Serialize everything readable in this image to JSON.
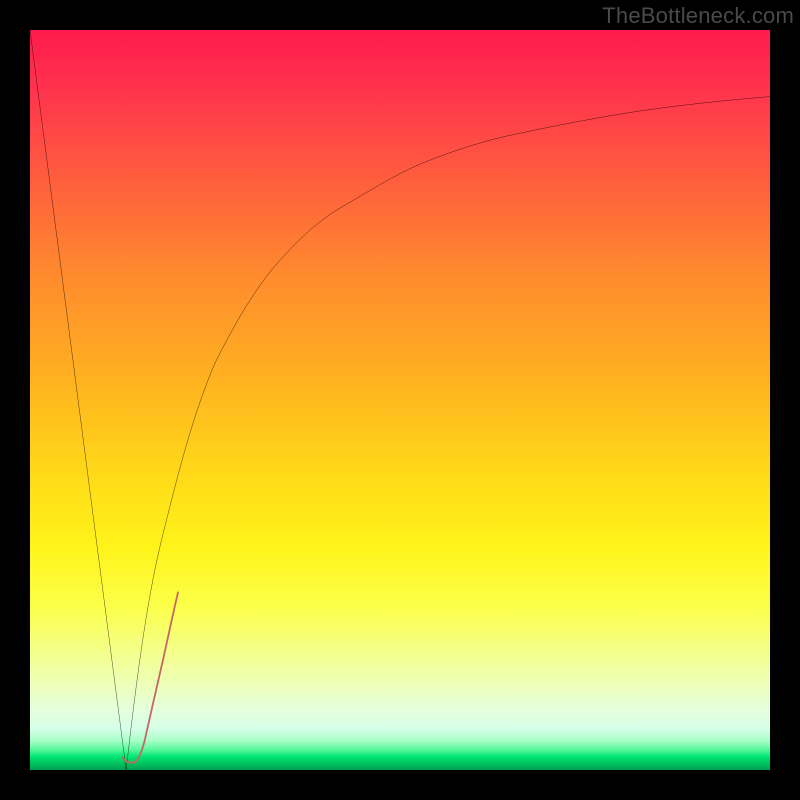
{
  "watermark": "TheBottleneck.com",
  "colors": {
    "frame": "#000000",
    "curve": "#000000",
    "indicator": "#c46767",
    "gradient_top": "#ff1a4d",
    "gradient_mid": "#ffd918",
    "gradient_bottom": "#00c860"
  },
  "chart_data": {
    "type": "line",
    "title": "",
    "xlabel": "",
    "ylabel": "",
    "xlim": [
      0,
      100
    ],
    "ylim": [
      0,
      100
    ],
    "grid": false,
    "legend": false,
    "background": "red-yellow-green vertical gradient",
    "series": [
      {
        "name": "left-descent",
        "x": [
          0,
          13
        ],
        "y": [
          100,
          0
        ]
      },
      {
        "name": "right-log-curve",
        "x": [
          13,
          18,
          25,
          33,
          42,
          53,
          66,
          82,
          100
        ],
        "y": [
          0,
          32,
          55,
          68,
          76,
          82,
          86,
          89,
          91
        ]
      },
      {
        "name": "indicator-hook",
        "stroke": "#c46767",
        "stroke_width": 13,
        "x": [
          12.5,
          13.5,
          14.0,
          15.5,
          18.0,
          20.0
        ],
        "y": [
          1.7,
          1.0,
          1.0,
          4.0,
          15.0,
          24.0
        ]
      }
    ],
    "annotations": [
      {
        "text": "TheBottleneck.com",
        "position": "top-right",
        "role": "watermark"
      }
    ]
  }
}
